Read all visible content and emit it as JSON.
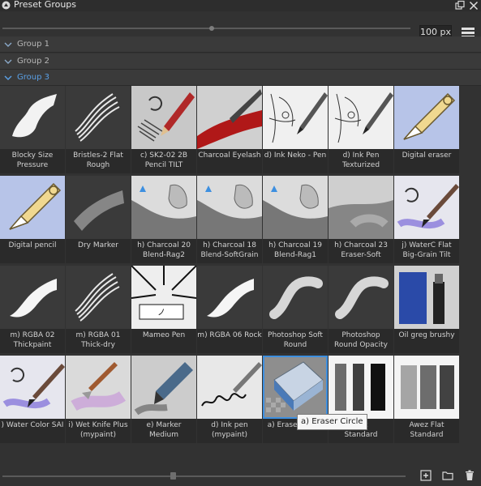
{
  "window": {
    "title": "Preset Groups"
  },
  "toolbar": {
    "size_value": "100 px"
  },
  "groups": [
    {
      "label": "Group 1",
      "expanded": false
    },
    {
      "label": "Group 2",
      "expanded": false
    },
    {
      "label": "Group 3",
      "expanded": true
    }
  ],
  "presets": [
    {
      "label": "Blocky Size\nPressure",
      "icon": "blocky-stroke"
    },
    {
      "label": "Bristles-2 Flat\nRough",
      "icon": "bristle-stroke"
    },
    {
      "label": "c) SK2-02 2B\nPencil TILT",
      "icon": "pencil-tilt"
    },
    {
      "label": "Charcoal Eyelash",
      "icon": "charcoal-red"
    },
    {
      "label": "d) Ink Neko - Pen",
      "icon": "ink-pen-sketch"
    },
    {
      "label": "d) Ink Pen\nTexturized",
      "icon": "ink-pen-sketch"
    },
    {
      "label": "Digital eraser",
      "icon": "digital-pencil"
    },
    {
      "label": "Digital pencil",
      "icon": "digital-pencil"
    },
    {
      "label": "Dry Marker",
      "icon": "dry-marker"
    },
    {
      "label": "h) Charcoal 20\nBlend-Rag2",
      "icon": "charcoal-blend"
    },
    {
      "label": "h) Charcoal 18\nBlend-SoftGrain",
      "icon": "charcoal-blend"
    },
    {
      "label": "h) Charcoal 19\nBlend-Rag1",
      "icon": "charcoal-blend"
    },
    {
      "label": "h) Charcoal 23\nEraser-Soft",
      "icon": "charcoal-eraser"
    },
    {
      "label": "j) WaterC Flat\nBig-Grain Tilt",
      "icon": "watercolor-brush"
    },
    {
      "label": "m) RGBA 02\nThickpaint",
      "icon": "thick-stroke"
    },
    {
      "label": "m) RGBA 01\nThick-dry",
      "icon": "bristle-stroke"
    },
    {
      "label": "Mameo Pen",
      "icon": "manga"
    },
    {
      "label": "m) RGBA 06 Rock",
      "icon": "thick-stroke"
    },
    {
      "label": "Photoshop Soft\nRound",
      "icon": "soft-stroke"
    },
    {
      "label": "Photoshop\nRound Opacity",
      "icon": "soft-stroke"
    },
    {
      "label": "Oil greg brushy",
      "icon": "oil-paint"
    },
    {
      "label": ") Water Color SAI",
      "icon": "watercolor-brush"
    },
    {
      "label": "i) Wet Knife Plus\n(mypaint)",
      "icon": "palette-knife"
    },
    {
      "label": "e) Marker\nMedium",
      "icon": "marker"
    },
    {
      "label": "d) Ink pen\n(mypaint)",
      "icon": "ink-pen-scribble"
    },
    {
      "label": "a) Eraser Circle",
      "icon": "eraser"
    },
    {
      "label": "Flat\nStandard",
      "icon": "flat-bars"
    },
    {
      "label": "Awez Flat\nStandard",
      "icon": "flat-bars-light"
    }
  ],
  "selected_index": 25,
  "tooltip": {
    "text": "a) Eraser Circle"
  },
  "colors": {
    "accent": "#3d8fe0",
    "group_active": "#5aa0e6",
    "panel": "#323232"
  }
}
